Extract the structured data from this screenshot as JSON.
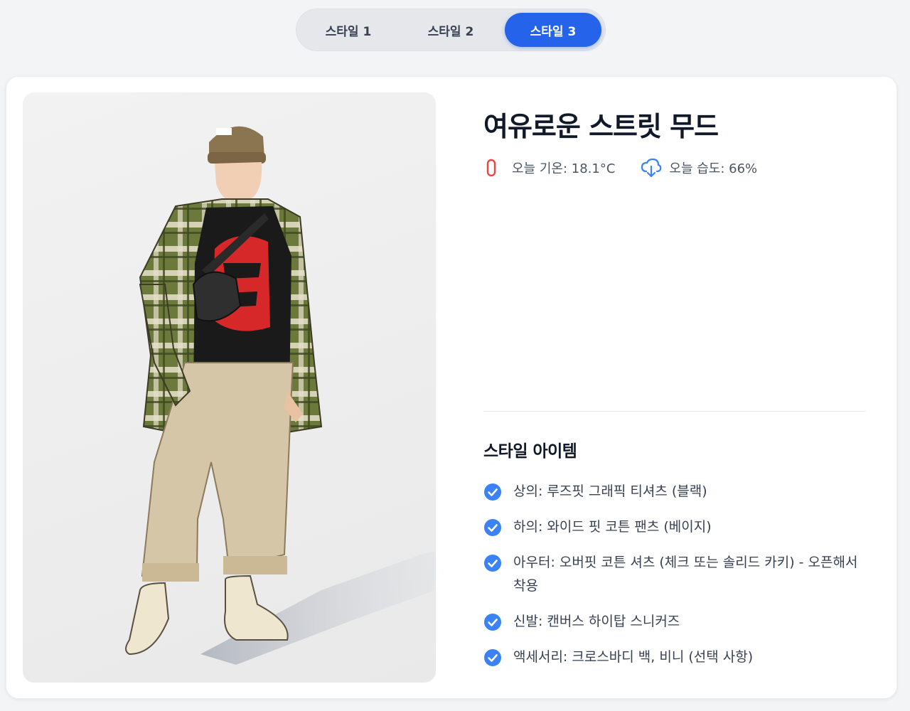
{
  "tabs": [
    {
      "label": "스타일 1",
      "active": false
    },
    {
      "label": "스타일 2",
      "active": false
    },
    {
      "label": "스타일 3",
      "active": true
    }
  ],
  "outfit": {
    "title": "여유로운 스트릿 무드",
    "temperature_text": "오늘 기온: 18.1°C",
    "humidity_text": "오늘 습도: 66%",
    "temperature_icon": "thermometer-icon",
    "humidity_icon": "cloud-download-icon"
  },
  "style_items": {
    "heading": "스타일 아이템",
    "items": [
      "상의: 루즈핏 그래픽 티셔츠 (블랙)",
      "하의: 와이드 핏 코튼 팬츠 (베이지)",
      "아우터: 오버핏 코튼 셔츠 (체크 또는 솔리드 카키) - 오픈해서 착용",
      "신발: 캔버스 하이탑 스니커즈",
      "액세서리: 크로스바디 백, 비니 (선택 사항)"
    ]
  },
  "colors": {
    "accent": "#2563eb",
    "check": "#3b82f6",
    "thermometer": "#ef4444",
    "background": "#f3f4f6"
  }
}
